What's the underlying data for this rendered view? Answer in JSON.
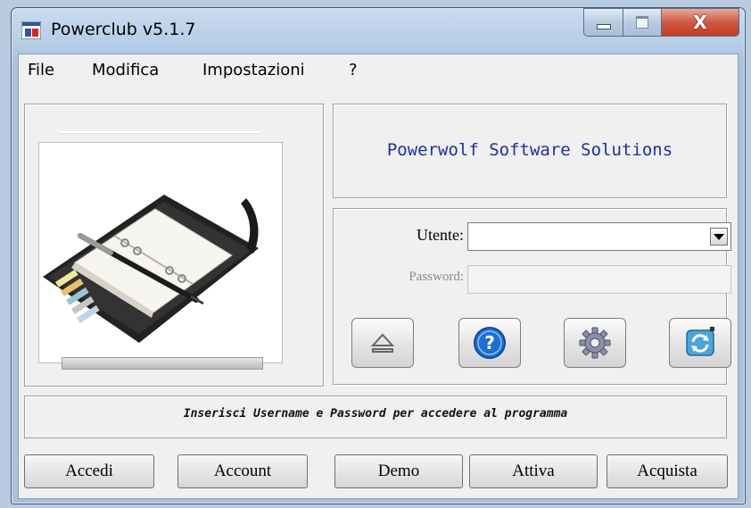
{
  "window": {
    "title": "Powerclub v5.1.7"
  },
  "menu": [
    "File",
    "Modifica",
    "Impostazioni",
    "?"
  ],
  "company": "Powerwolf Software Solutions",
  "login": {
    "user_label": "Utente:",
    "user_value": "",
    "password_label": "Password:",
    "password_value": ""
  },
  "icon_buttons": [
    "eject-icon",
    "help-icon",
    "gear-icon",
    "refresh-icon"
  ],
  "status": "Inserisci Username e Password per accedere al programma",
  "buttons": [
    "Accedi",
    "Account",
    "Demo",
    "Attiva",
    "Acquista"
  ],
  "colors": {
    "company_text": "#1d2fa8",
    "help_blue": "#1f6fd0",
    "close_red": "#c23b22"
  }
}
